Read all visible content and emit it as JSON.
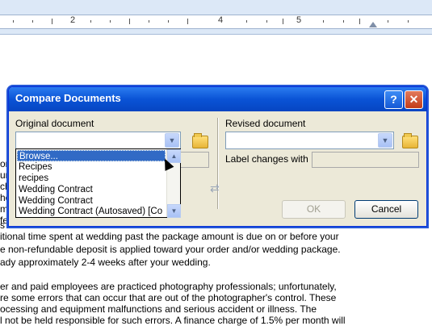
{
  "ruler": {
    "numbers": [
      "2",
      "4",
      "5"
    ]
  },
  "document": {
    "lines": [
      "or",
      "ur",
      "ch",
      "he",
      "mi",
      "fer",
      "s",
      "itional time spent at wedding past the  package amount is due on or before your",
      "e non-refundable deposit is applied toward your order and/or wedding package.",
      "ady approximately 2-4 weeks after your wedding.",
      "er and paid employees are practiced photography professionals; unfortunately,",
      "re some errors that can occur that are out of the photographer's control. These",
      "ocessing and equipment malfunctions and serious accident or illness. The",
      "l not be held responsible for such errors. A finance charge of 1.5% per month will"
    ]
  },
  "dialog": {
    "title": "Compare Documents",
    "help_label": "?",
    "close_label": "✕",
    "original_label": "Original document",
    "revised_label": "Revised document",
    "label_changes_with": "Label changes with",
    "ok_label": "OK",
    "cancel_label": "Cancel",
    "icons": {
      "folder": "folder-open-icon",
      "swap": "swap-arrows-icon"
    }
  },
  "dropdown": {
    "items": [
      "Browse...",
      "Recipes",
      "recipes",
      "Wedding Contract",
      "Wedding Contract",
      "Wedding Contract (Autosaved) [Co"
    ],
    "selected_index": 0
  },
  "colors": {
    "accent": "#0a53d6",
    "selection": "#316ac5",
    "dialog_bg": "#ece9d8"
  }
}
